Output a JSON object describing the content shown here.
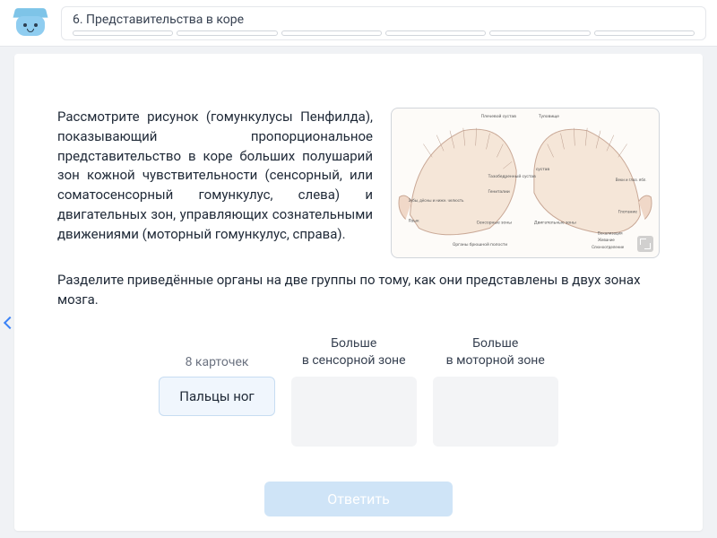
{
  "header": {
    "breadcrumb_title": "6. Представительства в коре"
  },
  "task": {
    "paragraph1": "Рассмотрите рисунок (гомункулусы Пенфилда), показывающий пропорциональное представительство в коре больших полушарий зон кожной чувствительности (сенсорный, или соматосенсорный гомункулус, слева) и двигательных зон, управляющих сознательными движениями (моторный гомункулус, справа).",
    "paragraph2": "Разделите приведённые органы на две группы по тому, как они представлены в двух зонах мозга."
  },
  "image_labels": {
    "top_left": "Плечевой сустав",
    "top_right": "Туловище",
    "hip": "Тазобедренный сустав",
    "genitals": "Гениталии",
    "teeth": "Зубы, дёсны и нижн. челюсть",
    "tongue": "Язык",
    "sensory": "Сенсорные зоны",
    "motor": "Двигательные зоны",
    "abdomen": "Органы брюшной полости",
    "swallow": "Глотание",
    "vocal": "Вокализация",
    "jaw": "Жевание",
    "saliva": "Слюноотделение",
    "eye": "Веки и глаз. ябл."
  },
  "sort": {
    "count_label": "8 карточек",
    "current_card": "Пальцы ног",
    "zone1_label": "Больше\nв сенсорной зоне",
    "zone2_label": "Больше\nв моторной зоне"
  },
  "submit_label": "Ответить"
}
